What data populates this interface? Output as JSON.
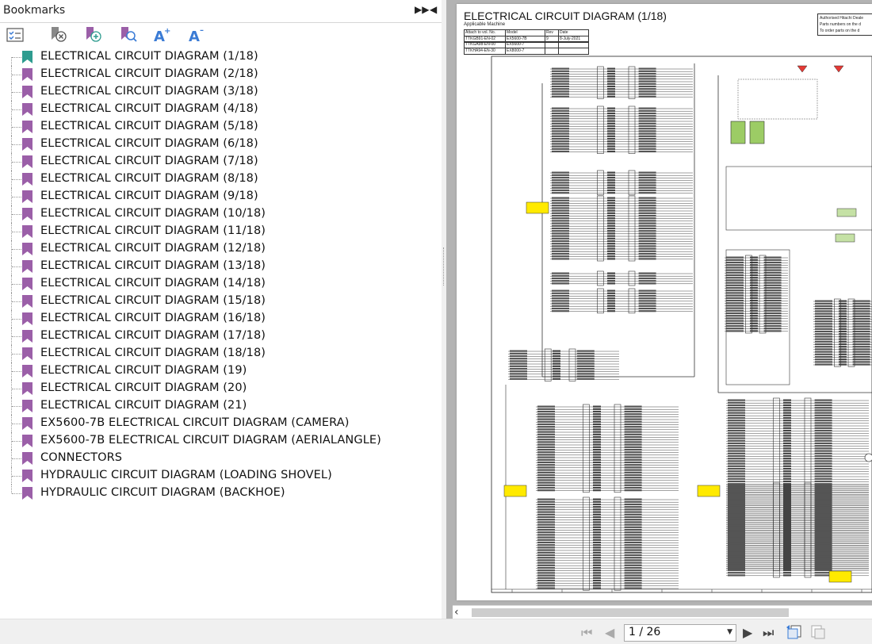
{
  "bookmarks_panel": {
    "title": "Bookmarks",
    "items": [
      {
        "label": "ELECTRICAL CIRCUIT DIAGRAM (1/18)",
        "active": true
      },
      {
        "label": "ELECTRICAL CIRCUIT DIAGRAM (2/18)"
      },
      {
        "label": "ELECTRICAL CIRCUIT DIAGRAM (3/18)"
      },
      {
        "label": "ELECTRICAL CIRCUIT DIAGRAM (4/18)"
      },
      {
        "label": "ELECTRICAL CIRCUIT DIAGRAM (5/18)"
      },
      {
        "label": "ELECTRICAL CIRCUIT DIAGRAM (6/18)"
      },
      {
        "label": "ELECTRICAL CIRCUIT DIAGRAM (7/18)"
      },
      {
        "label": "ELECTRICAL CIRCUIT DIAGRAM (8/18)"
      },
      {
        "label": "ELECTRICAL CIRCUIT DIAGRAM (9/18)"
      },
      {
        "label": "ELECTRICAL CIRCUIT DIAGRAM (10/18)"
      },
      {
        "label": "ELECTRICAL CIRCUIT DIAGRAM (11/18)"
      },
      {
        "label": "ELECTRICAL CIRCUIT DIAGRAM (12/18)"
      },
      {
        "label": "ELECTRICAL CIRCUIT DIAGRAM (13/18)"
      },
      {
        "label": "ELECTRICAL CIRCUIT DIAGRAM (14/18)"
      },
      {
        "label": "ELECTRICAL CIRCUIT DIAGRAM (15/18)"
      },
      {
        "label": "ELECTRICAL CIRCUIT DIAGRAM (16/18)"
      },
      {
        "label": "ELECTRICAL CIRCUIT DIAGRAM (17/18)"
      },
      {
        "label": "ELECTRICAL CIRCUIT DIAGRAM (18/18)"
      },
      {
        "label": "ELECTRICAL CIRCUIT DIAGRAM (19)"
      },
      {
        "label": "ELECTRICAL CIRCUIT DIAGRAM (20)"
      },
      {
        "label": "ELECTRICAL CIRCUIT DIAGRAM (21)"
      },
      {
        "label": "EX5600-7B ELECTRICAL CIRCUIT DIAGRAM (CAMERA)"
      },
      {
        "label": "EX5600-7B ELECTRICAL CIRCUIT DIAGRAM (AERIALANGLE)"
      },
      {
        "label": "CONNECTORS"
      },
      {
        "label": "HYDRAULIC CIRCUIT DIAGRAM (LOADING SHOVEL)"
      },
      {
        "label": "HYDRAULIC CIRCUIT DIAGRAM (BACKHOE)"
      }
    ],
    "colors": {
      "active_flag": "#2e9c8f",
      "flag": "#9b5fa8"
    }
  },
  "document": {
    "title": "ELECTRICAL CIRCUIT DIAGRAM (1/18)",
    "applicable_machine": "Applicable Machine",
    "table": {
      "rows": [
        [
          "Attach to vol. No.",
          "Model",
          "Rev",
          "Date"
        ],
        [
          "TTKGB91-EN-02",
          "EX5600-7B",
          "9",
          "8-July-2021"
        ],
        [
          "TTKGA98-EN-00",
          "EX5600-7",
          "",
          ""
        ],
        [
          "TTKHA94-EN-30",
          "EX8000-7",
          "",
          ""
        ]
      ]
    },
    "notice": [
      "Authorised Hitachi Deale",
      "Parts numbers on the d",
      "To order parts on the d"
    ]
  },
  "navigation": {
    "page_indicator": "1 / 26",
    "colors": {
      "icon": "#444444",
      "disabled": "#aaaaaa"
    }
  }
}
